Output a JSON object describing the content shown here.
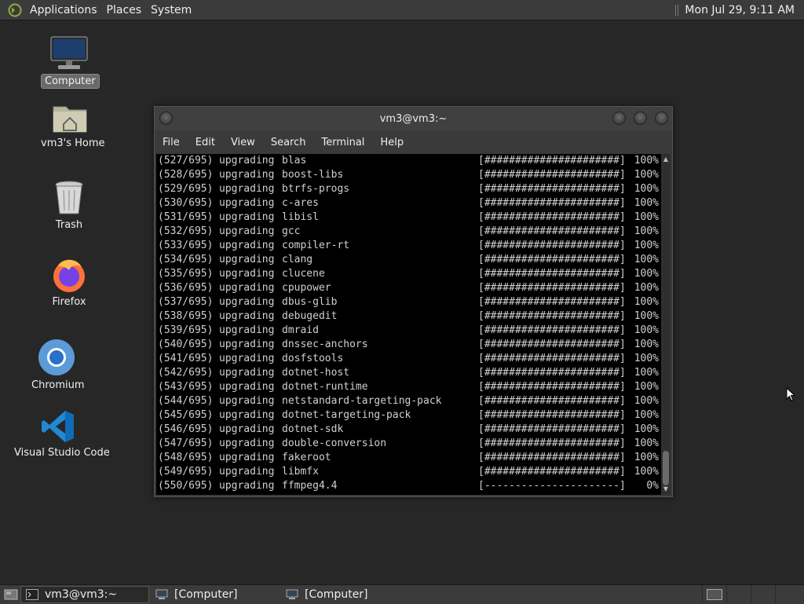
{
  "top_panel": {
    "menus": [
      "Applications",
      "Places",
      "System"
    ],
    "clock": "Mon Jul 29,  9:11 AM"
  },
  "desktop": {
    "icons": [
      {
        "label": "Computer",
        "icon": "computer-icon",
        "selected": true
      },
      {
        "label": "vm3's Home",
        "icon": "home-folder-icon"
      },
      {
        "label": "Trash",
        "icon": "trash-icon"
      },
      {
        "label": "Firefox",
        "icon": "firefox-icon"
      },
      {
        "label": "Chromium",
        "icon": "chromium-icon"
      },
      {
        "label": "Visual Studio Code",
        "icon": "vscode-icon"
      }
    ]
  },
  "terminal": {
    "title": "vm3@vm3:~",
    "menu": [
      "File",
      "Edit",
      "View",
      "Search",
      "Terminal",
      "Help"
    ],
    "lines": [
      {
        "idx": "(527/695)",
        "action": "upgrading",
        "pkg": "blas",
        "bar": "[######################]",
        "pct": "100%"
      },
      {
        "idx": "(528/695)",
        "action": "upgrading",
        "pkg": "boost-libs",
        "bar": "[######################]",
        "pct": "100%"
      },
      {
        "idx": "(529/695)",
        "action": "upgrading",
        "pkg": "btrfs-progs",
        "bar": "[######################]",
        "pct": "100%"
      },
      {
        "idx": "(530/695)",
        "action": "upgrading",
        "pkg": "c-ares",
        "bar": "[######################]",
        "pct": "100%"
      },
      {
        "idx": "(531/695)",
        "action": "upgrading",
        "pkg": "libisl",
        "bar": "[######################]",
        "pct": "100%"
      },
      {
        "idx": "(532/695)",
        "action": "upgrading",
        "pkg": "gcc",
        "bar": "[######################]",
        "pct": "100%"
      },
      {
        "idx": "(533/695)",
        "action": "upgrading",
        "pkg": "compiler-rt",
        "bar": "[######################]",
        "pct": "100%"
      },
      {
        "idx": "(534/695)",
        "action": "upgrading",
        "pkg": "clang",
        "bar": "[######################]",
        "pct": "100%"
      },
      {
        "idx": "(535/695)",
        "action": "upgrading",
        "pkg": "clucene",
        "bar": "[######################]",
        "pct": "100%"
      },
      {
        "idx": "(536/695)",
        "action": "upgrading",
        "pkg": "cpupower",
        "bar": "[######################]",
        "pct": "100%"
      },
      {
        "idx": "(537/695)",
        "action": "upgrading",
        "pkg": "dbus-glib",
        "bar": "[######################]",
        "pct": "100%"
      },
      {
        "idx": "(538/695)",
        "action": "upgrading",
        "pkg": "debugedit",
        "bar": "[######################]",
        "pct": "100%"
      },
      {
        "idx": "(539/695)",
        "action": "upgrading",
        "pkg": "dmraid",
        "bar": "[######################]",
        "pct": "100%"
      },
      {
        "idx": "(540/695)",
        "action": "upgrading",
        "pkg": "dnssec-anchors",
        "bar": "[######################]",
        "pct": "100%"
      },
      {
        "idx": "(541/695)",
        "action": "upgrading",
        "pkg": "dosfstools",
        "bar": "[######################]",
        "pct": "100%"
      },
      {
        "idx": "(542/695)",
        "action": "upgrading",
        "pkg": "dotnet-host",
        "bar": "[######################]",
        "pct": "100%"
      },
      {
        "idx": "(543/695)",
        "action": "upgrading",
        "pkg": "dotnet-runtime",
        "bar": "[######################]",
        "pct": "100%"
      },
      {
        "idx": "(544/695)",
        "action": "upgrading",
        "pkg": "netstandard-targeting-pack",
        "bar": "[######################]",
        "pct": "100%"
      },
      {
        "idx": "(545/695)",
        "action": "upgrading",
        "pkg": "dotnet-targeting-pack",
        "bar": "[######################]",
        "pct": "100%"
      },
      {
        "idx": "(546/695)",
        "action": "upgrading",
        "pkg": "dotnet-sdk",
        "bar": "[######################]",
        "pct": "100%"
      },
      {
        "idx": "(547/695)",
        "action": "upgrading",
        "pkg": "double-conversion",
        "bar": "[######################]",
        "pct": "100%"
      },
      {
        "idx": "(548/695)",
        "action": "upgrading",
        "pkg": "fakeroot",
        "bar": "[######################]",
        "pct": "100%"
      },
      {
        "idx": "(549/695)",
        "action": "upgrading",
        "pkg": "libmfx",
        "bar": "[######################]",
        "pct": "100%"
      },
      {
        "idx": "(550/695)",
        "action": "upgrading",
        "pkg": "ffmpeg4.4",
        "bar": "[----------------------]",
        "pct": "0%"
      }
    ]
  },
  "taskbar": {
    "tasks": [
      {
        "label": "vm3@vm3:~",
        "icon": "terminal-icon",
        "active": true
      },
      {
        "label": "[Computer]",
        "icon": "computer-small-icon",
        "active": false
      },
      {
        "label": "[Computer]",
        "icon": "computer-small-icon",
        "active": false
      }
    ]
  }
}
